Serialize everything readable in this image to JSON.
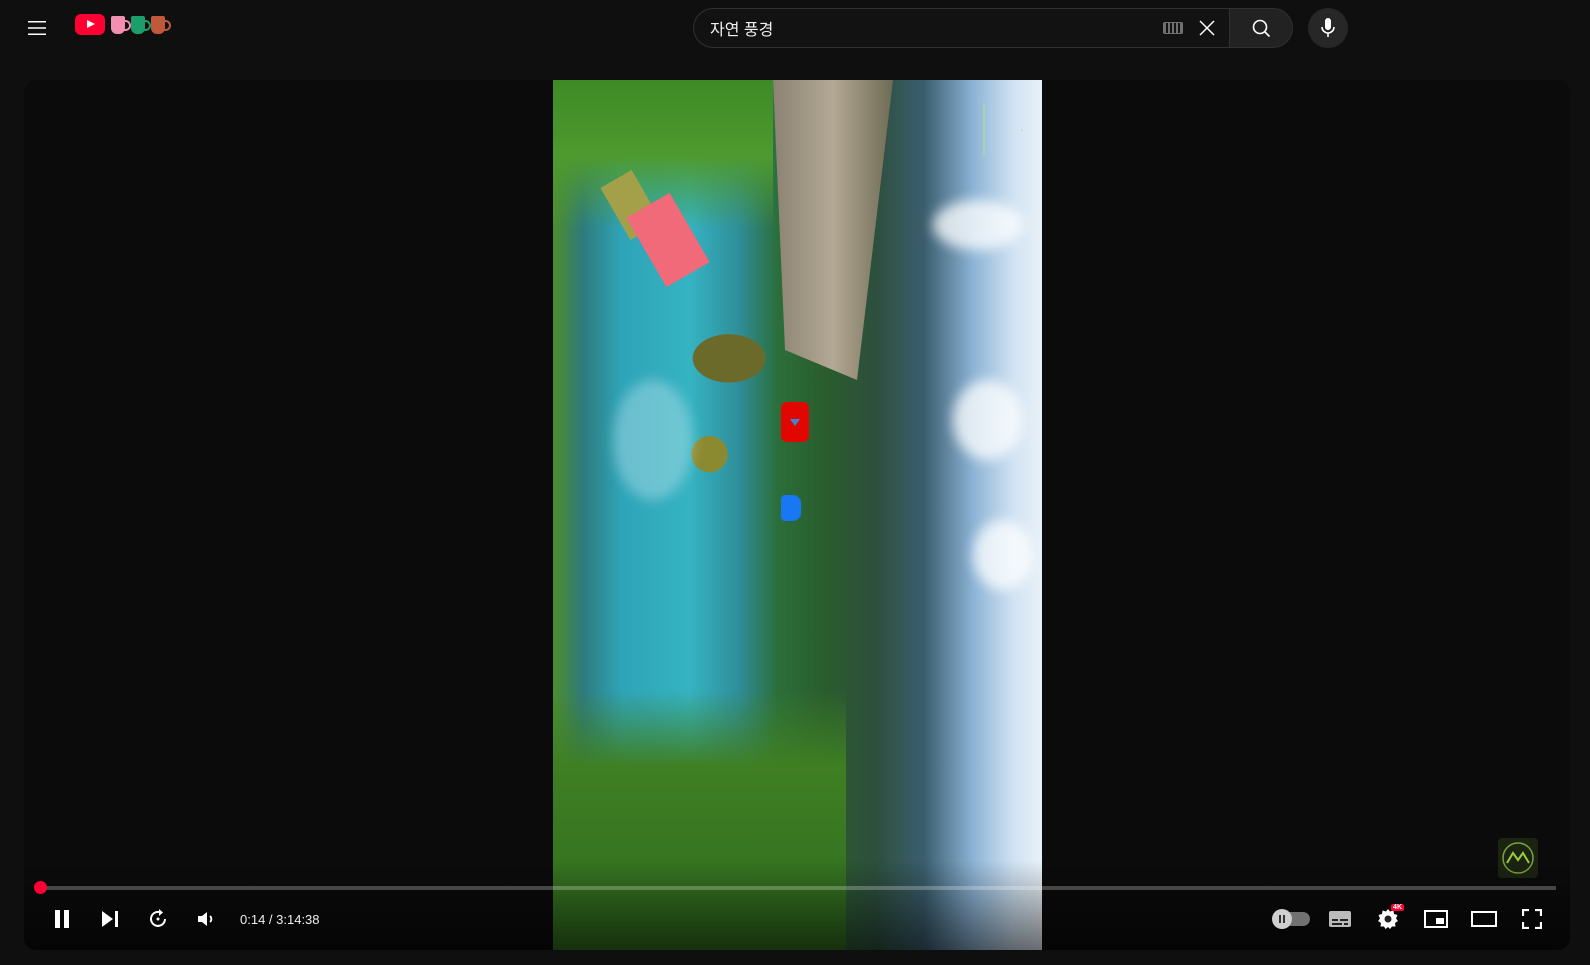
{
  "header": {
    "search": {
      "value": "자연 풍경"
    }
  },
  "player": {
    "time_current": "0:14",
    "time_total": "3:14:38",
    "time_display": "0:14 / 3:14:38",
    "progress_fraction": 0.0012,
    "quality_badge": "4K",
    "accent_color": "#ff0033"
  }
}
